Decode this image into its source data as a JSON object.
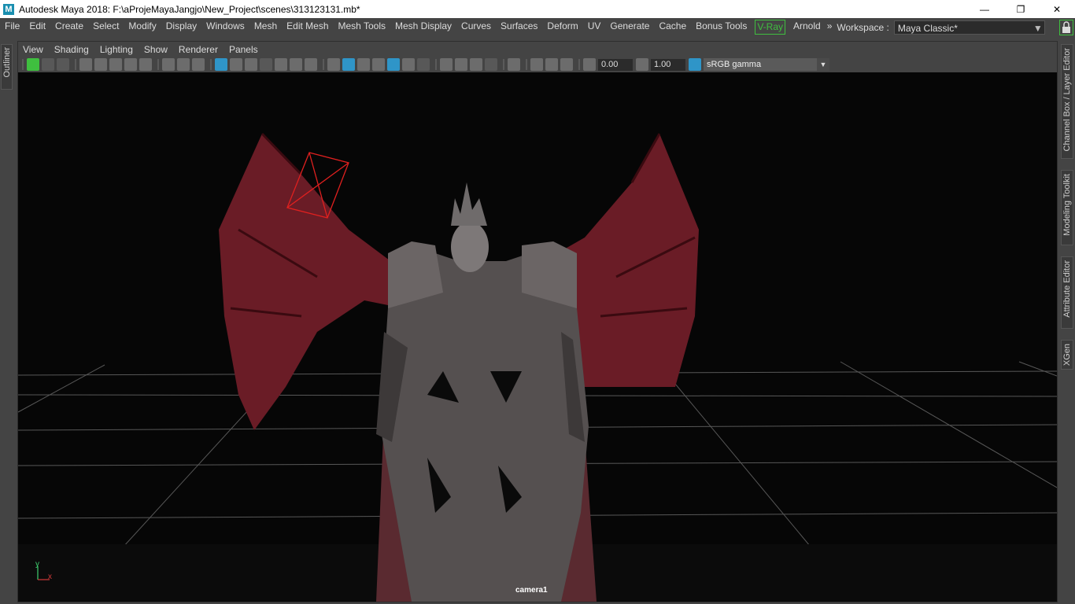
{
  "window": {
    "title": "Autodesk Maya 2018: F:\\aProjeMayaJangjo\\New_Project\\scenes\\313123131.mb*",
    "logo_letter": "M",
    "minimize_glyph": "—",
    "maximize_glyph": "❐",
    "close_glyph": "✕"
  },
  "menubar": {
    "items": [
      "File",
      "Edit",
      "Create",
      "Select",
      "Modify",
      "Display",
      "Windows",
      "Mesh",
      "Edit Mesh",
      "Mesh Tools",
      "Mesh Display",
      "Curves",
      "Surfaces",
      "Deform",
      "UV",
      "Generate",
      "Cache",
      "Bonus Tools",
      "V-Ray",
      "Arnold"
    ],
    "chevron": "»",
    "workspace_label": "Workspace :",
    "workspace_value": "Maya Classic*",
    "accent": "#3fbf3f"
  },
  "left_tabs": {
    "outliner": "Outliner"
  },
  "panel": {
    "menu": [
      "View",
      "Shading",
      "Lighting",
      "Show",
      "Renderer",
      "Panels"
    ],
    "exposure": "0.00",
    "gamma": "1.00",
    "colorspace": "sRGB gamma",
    "highlight_color": "#2f95c8"
  },
  "viewport": {
    "camera_label": "camera1",
    "axis_y": "y",
    "axis_x": "x",
    "background": "#060606"
  },
  "right_tabs": [
    "Channel Box / Layer Editor",
    "Modeling Toolkit",
    "Attribute Editor",
    "XGen"
  ]
}
